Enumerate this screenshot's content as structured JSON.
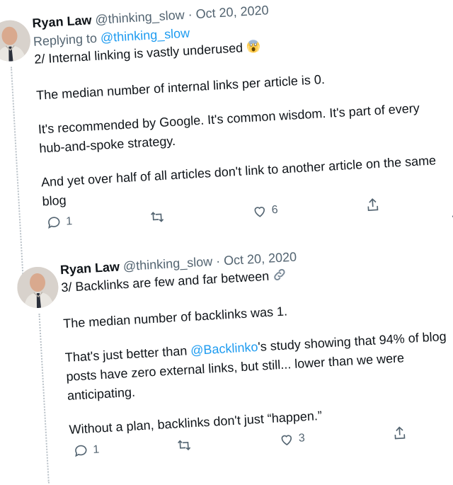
{
  "tweets": [
    {
      "author": "Ryan Law",
      "handle": "@thinking_slow",
      "separator": "·",
      "date": "Oct 20, 2020",
      "replying_prefix": "Replying to",
      "replying_to": "@thinking_slow",
      "line1": "2/ Internal linking is vastly underused",
      "line1_icon": "screaming-face-emoji-icon",
      "p2": "The median number of internal links per article is 0.",
      "p3a": "It's recommended by Google. It's common wisdom. It's part of every",
      "p3b": "hub-and-spoke strategy.",
      "p4a": "And yet over half of all articles don't link to another article on the same",
      "p4b": "blog",
      "replies": "1",
      "retweets": "",
      "likes": "6"
    },
    {
      "author": "Ryan Law",
      "handle": "@thinking_slow",
      "separator": "·",
      "date": "Oct 20, 2020",
      "line1": "3/ Backlinks are few and far between",
      "line1_icon": "link-icon",
      "p2": "The median number of backlinks was 1.",
      "p3_pre": "That's just better than ",
      "p3_mention": "@Backlinko",
      "p3_post": "'s study showing that 94% of blog",
      "p3b": "posts have zero external links, but still... lower than we were",
      "p3c": "anticipating.",
      "p4": "Without a plan, backlinks don't just “happen.”",
      "replies": "1",
      "retweets": "",
      "likes": "3"
    }
  ],
  "colors": {
    "text": "#0f1419",
    "secondary": "#536471",
    "link": "#1d9bf0"
  }
}
